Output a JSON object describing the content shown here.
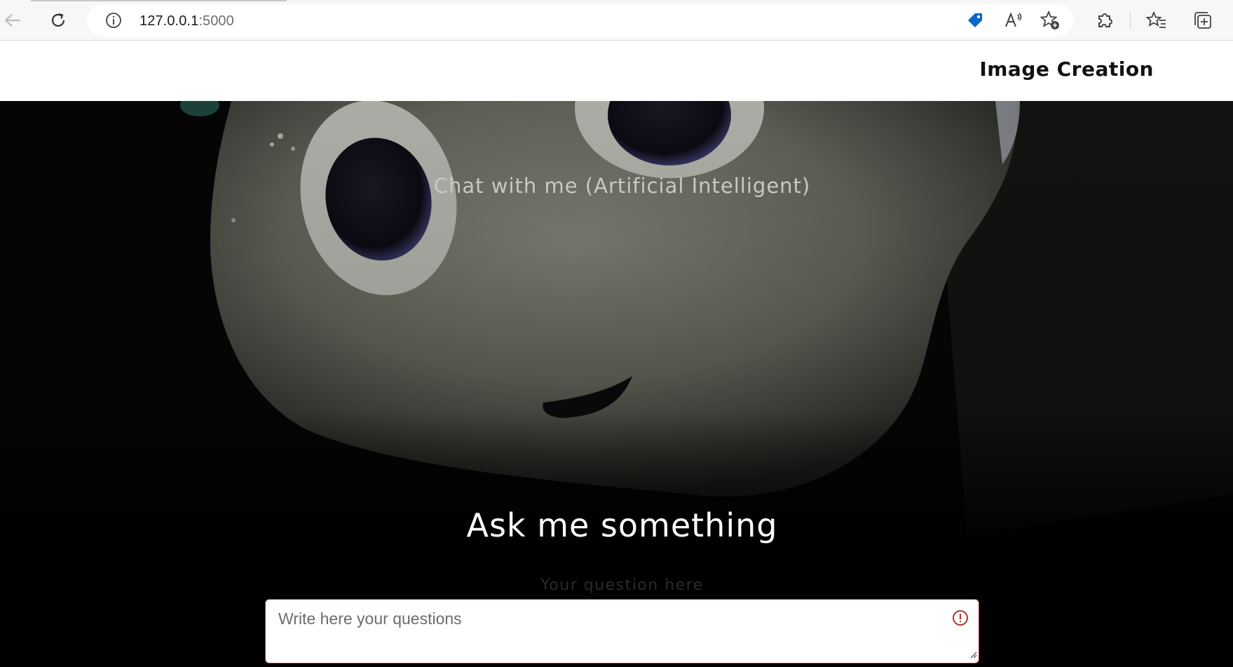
{
  "browser": {
    "url_host": "127.0.0.1",
    "url_port": ":5000",
    "icons": [
      "back-arrow-icon",
      "refresh-icon",
      "site-info-icon",
      "shopping-tag-icon",
      "read-aloud-icon",
      "add-favorite-icon",
      "extensions-icon",
      "favorites-icon",
      "collections-icon"
    ],
    "tag_color": "#0a67c9"
  },
  "header": {
    "brand": "Image Creation"
  },
  "hero": {
    "subtitle": "Chat with me (Artificial Intelligent)",
    "heading": "Ask me something",
    "question_label": "Your question here",
    "question_placeholder": "Write here your questions",
    "warning_color": "#b03434"
  }
}
